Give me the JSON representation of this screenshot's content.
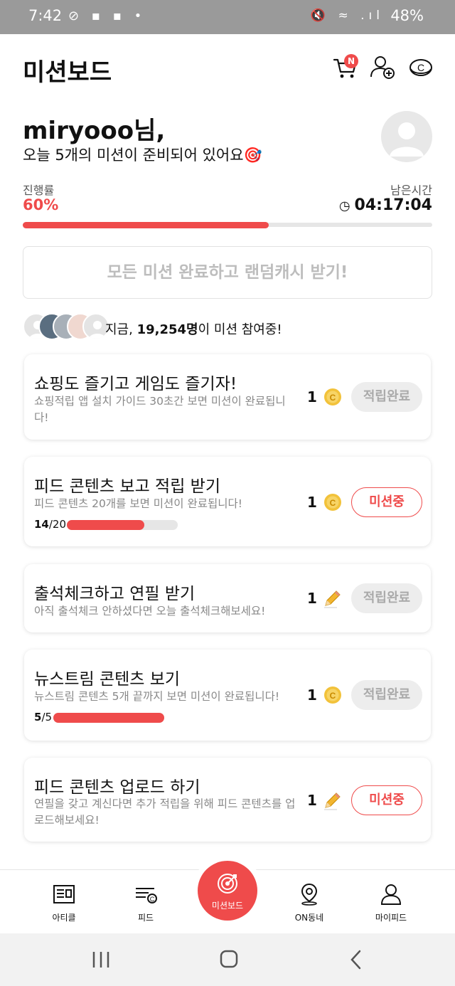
{
  "status_bar": {
    "time": "7:42",
    "left_icons": "⊘ ▪ ▪ •",
    "right_icons": "🔇 ≈ .ıl",
    "battery": "48%"
  },
  "header": {
    "title": "미션보드",
    "cart_badge": "N",
    "icons": [
      "cart-icon",
      "add-friend-icon",
      "coin-icon"
    ]
  },
  "greeting": {
    "name": "miryooo님,",
    "subtitle": "오늘 5개의 미션이 준비되어 있어요🎯"
  },
  "progress": {
    "label": "진행률",
    "percent_text": "60%",
    "percent": 60,
    "remaining_label": "남은시간",
    "remaining_time": "04:17:04"
  },
  "complete_all_button": "모든 미션 완료하고 랜덤캐시 받기!",
  "participants": {
    "prefix": "지금, ",
    "count": "19,254명",
    "suffix": "이 미션 참여중!"
  },
  "missions": [
    {
      "title": "쇼핑도 즐기고 게임도 즐기자!",
      "desc": "쇼핑적립 앱 설치 가이드 30초간 보면 미션이 완료됩니다!",
      "reward": "1",
      "reward_icon": "coin-icon",
      "status": "적립완료"
    },
    {
      "title": "피드 콘텐츠 보고 적립 받기",
      "desc": "피드 콘텐츠 20개를 보면 미션이 완료됩니다!",
      "reward": "1",
      "reward_icon": "coin-icon",
      "status": "미션중",
      "progress_done": "14",
      "progress_total": "/20",
      "progress_fraction": 0.7
    },
    {
      "title": "출석체크하고 연필 받기",
      "desc": "아직 출석체크 안하셨다면 오늘 출석체크해보세요!",
      "reward": "1",
      "reward_icon": "pencil-icon",
      "status": "적립완료"
    },
    {
      "title": "뉴스트림 콘텐츠 보기",
      "desc": "뉴스트림 콘텐츠 5개 끝까지 보면 미션이 완료됩니다!",
      "reward": "1",
      "reward_icon": "coin-icon",
      "status": "적립완료",
      "progress_done": "5",
      "progress_total": "/5",
      "progress_fraction": 1.0
    },
    {
      "title": "피드 콘텐츠 업로드 하기",
      "desc": "연필을 갖고 계신다면 추가 적립을 위해 피드 콘텐츠를 업로드해보세요!",
      "reward": "1",
      "reward_icon": "pencil-icon",
      "status": "미션중"
    }
  ],
  "bottom_nav": {
    "article": "아티클",
    "feed": "피드",
    "missionboard": "미션보드",
    "on_neighborhood": "ON동네",
    "mypage": "마이피드"
  },
  "colors": {
    "accent": "#ef4b4b",
    "coin": "#f2c23a",
    "muted_button": "#ededed"
  }
}
